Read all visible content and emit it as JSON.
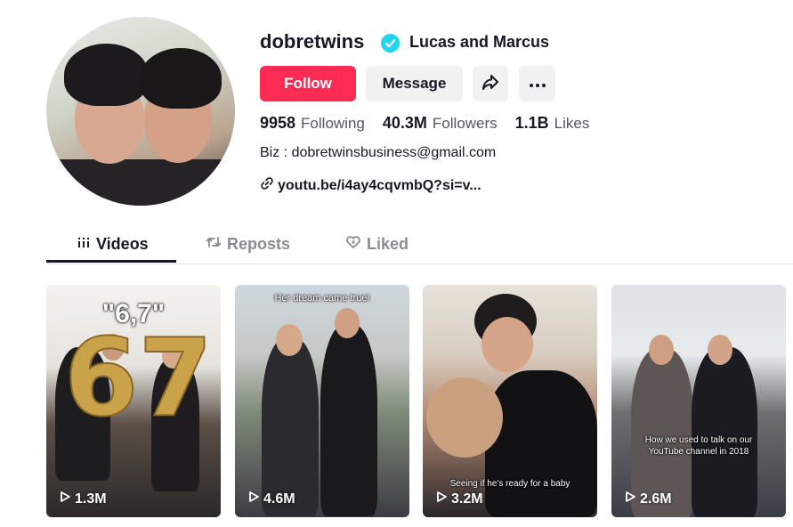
{
  "profile": {
    "username": "dobretwins",
    "nickname": "Lucas and Marcus",
    "verified_icon": "verified-badge-icon",
    "avatar_icon": "profile-avatar"
  },
  "actions": {
    "follow_label": "Follow",
    "message_label": "Message",
    "share_icon": "share-icon",
    "more_icon": "more-icon",
    "follow_color": "#fe2c55"
  },
  "stats": {
    "following_count": "9958",
    "following_label": "Following",
    "followers_count": "40.3M",
    "followers_label": "Followers",
    "likes_count": "1.1B",
    "likes_label": "Likes"
  },
  "bio": {
    "text": "Biz : dobretwinsbusiness@gmail.com",
    "link": "youtu.be/i4ay4cqvmbQ?si=v..."
  },
  "tabs": [
    {
      "label": "Videos",
      "icon": "grid-icon",
      "active": true
    },
    {
      "label": "Reposts",
      "icon": "repost-icon",
      "active": false
    },
    {
      "label": "Liked",
      "icon": "liked-heart-icon",
      "active": false
    }
  ],
  "videos": [
    {
      "views": "1.3M",
      "caption": "\"6,7\"",
      "balloon": "67"
    },
    {
      "views": "4.6M",
      "caption": "Her dream came true!"
    },
    {
      "views": "3.2M",
      "caption": "Seeing if he's ready for a baby"
    },
    {
      "views": "2.6M",
      "caption_line1": "How we used to talk on our",
      "caption_line2": "YouTube channel in 2018"
    }
  ]
}
